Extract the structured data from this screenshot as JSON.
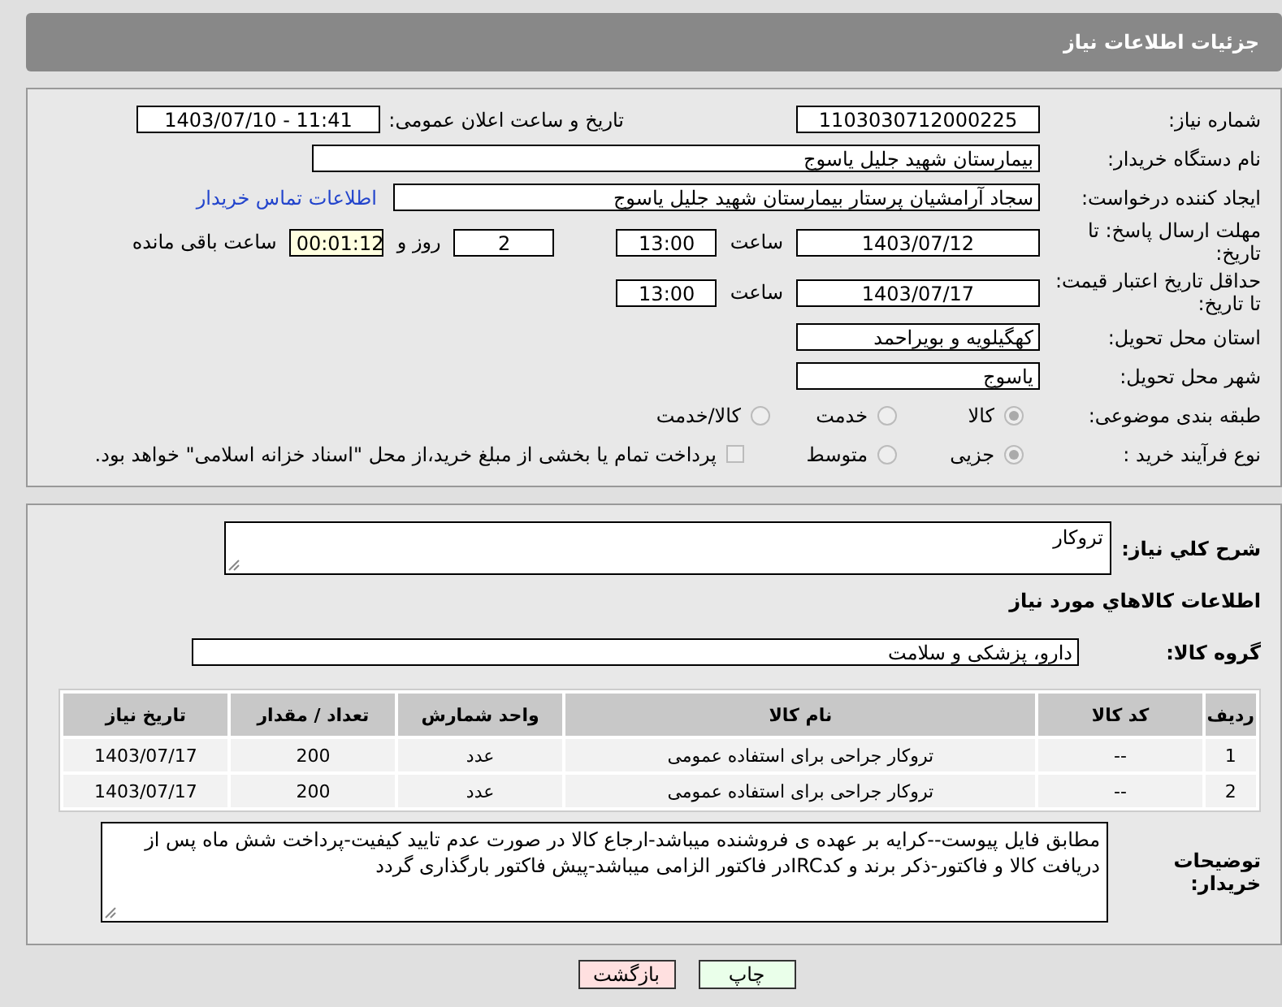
{
  "header": {
    "title": "جزئیات اطلاعات نیاز"
  },
  "details": {
    "need_number": {
      "label": "شماره نیاز:",
      "value": "1103030712000225"
    },
    "announce": {
      "label": "تاریخ و ساعت اعلان عمومی:",
      "value": "1403/07/10 - 11:41"
    },
    "buyer_org": {
      "label": "نام دستگاه خریدار:",
      "value": "بیمارستان شهید جلیل یاسوج"
    },
    "requester": {
      "label": "ایجاد کننده درخواست:",
      "value": "سجاد آرامشیان پرستار بیمارستان شهید جلیل یاسوج",
      "link": "اطلاعات تماس خریدار"
    },
    "reply_deadline": {
      "label": "مهلت ارسال پاسخ: تا تاریخ:",
      "date": "1403/07/12",
      "time_label": "ساعت",
      "time": "13:00",
      "days": "2",
      "days_label": "روز و",
      "remaining": "00:01:12",
      "remaining_label": "ساعت باقی مانده"
    },
    "price_validity": {
      "label": "حداقل تاریخ اعتبار قیمت: تا تاریخ:",
      "date": "1403/07/17",
      "time_label": "ساعت",
      "time": "13:00"
    },
    "province": {
      "label": "استان محل تحویل:",
      "value": "کهگیلویه و بویراحمد"
    },
    "city": {
      "label": "شهر محل تحویل:",
      "value": "یاسوج"
    },
    "category": {
      "label": "طبقه بندی موضوعی:",
      "options": [
        {
          "label": "کالا",
          "selected": true
        },
        {
          "label": "خدمت",
          "selected": false
        },
        {
          "label": "کالا/خدمت",
          "selected": false
        }
      ]
    },
    "process": {
      "label": "نوع فرآیند خرید :",
      "options": [
        {
          "label": "جزیی",
          "selected": true
        },
        {
          "label": "متوسط",
          "selected": false
        }
      ],
      "payment": {
        "label": "پرداخت تمام یا بخشی از مبلغ خرید،از محل \"اسناد خزانه اسلامی\" خواهد بود.",
        "checked": false
      }
    }
  },
  "goods": {
    "description": {
      "label": "شرح کلي نیاز:",
      "value": "تروکار"
    },
    "section_title": "اطلاعات کالاهاي مورد نیاز",
    "group": {
      "label": "گروه کالا:",
      "value": "دارو، پزشکی و سلامت"
    },
    "table": {
      "columns": [
        "ردیف",
        "کد کالا",
        "نام کالا",
        "واحد شمارش",
        "تعداد / مقدار",
        "تاریخ نیاز"
      ],
      "rows": [
        [
          "1",
          "--",
          "تروکار جراحی برای استفاده عمومی",
          "عدد",
          "200",
          "1403/07/17"
        ],
        [
          "2",
          "--",
          "تروکار جراحی برای استفاده عمومی",
          "عدد",
          "200",
          "1403/07/17"
        ]
      ]
    },
    "notes": {
      "label": "توضیحات خریدار:",
      "value": "مطابق فایل پیوست--کرایه بر عهده ی فروشنده میباشد-ارجاع کالا در صورت عدم تایید کیفیت-پرداخت شش ماه پس از دریافت کالا و فاکتور-ذکر برند و کدIRCدر فاکتور الزامی میباشد-پیش فاکتور بارگذاری گردد"
    }
  },
  "buttons": [
    {
      "kind": "print",
      "label": "چاپ"
    },
    {
      "kind": "back",
      "label": "بازگشت"
    }
  ]
}
